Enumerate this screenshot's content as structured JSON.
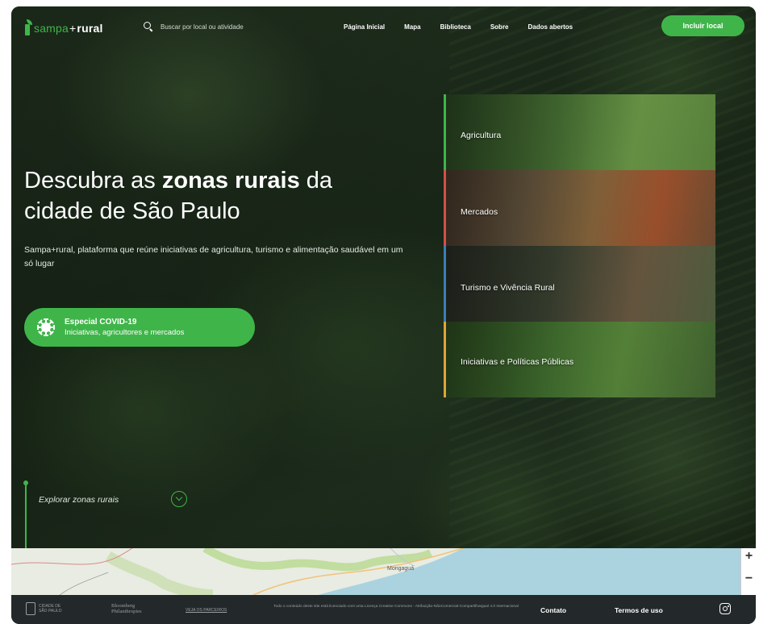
{
  "header": {
    "logo": {
      "part1": "sampa",
      "plus": "+",
      "part2": "rural"
    },
    "search_placeholder": "Buscar por local ou atividade",
    "nav": [
      "Página Inicial",
      "Mapa",
      "Biblioteca",
      "Sobre",
      "Dados abertos"
    ],
    "cta_label": "Incluir local"
  },
  "hero": {
    "title_pre": "Descubra as ",
    "title_bold": "zonas rurais",
    "title_post": " da cidade de São Paulo",
    "subtitle": "Sampa+rural, plataforma que reúne iniciativas de agricultura, turismo e alimentação saudável em um só lugar",
    "covid_title": "Especial COVID-19",
    "covid_subtitle": "Iniciativas, agricultores e mercados",
    "explore_label": "Explorar zonas rurais"
  },
  "categories": [
    {
      "label": "Agricultura",
      "accent": "#3fb549"
    },
    {
      "label": "Mercados",
      "accent": "#d2504a"
    },
    {
      "label": "Turismo e Vivência Rural",
      "accent": "#3b7fb6"
    },
    {
      "label": "Iniciativas e Políticas Públicas",
      "accent": "#e0a33a"
    }
  ],
  "map": {
    "place_label": "Mongaguá",
    "zoom_in": "+",
    "zoom_out": "−"
  },
  "footer": {
    "city_logo_line1": "CIDADE DE",
    "city_logo_line2": "SÃO PAULO",
    "bloomberg_line1": "Bloomberg",
    "bloomberg_line2": "Philanthropies",
    "partner_text": "VEJA OS PARCEIROS",
    "license_text": "Todo o conteúdo deste site está licenciado com uma Licença Creative Commons - Atribuição-NãoComercial-CompartilhaIgual 4.0 Internacional",
    "contato": "Contato",
    "termos": "Termos de uso"
  },
  "colors": {
    "brand_green": "#3fb549",
    "footer_bg": "#23282a"
  }
}
